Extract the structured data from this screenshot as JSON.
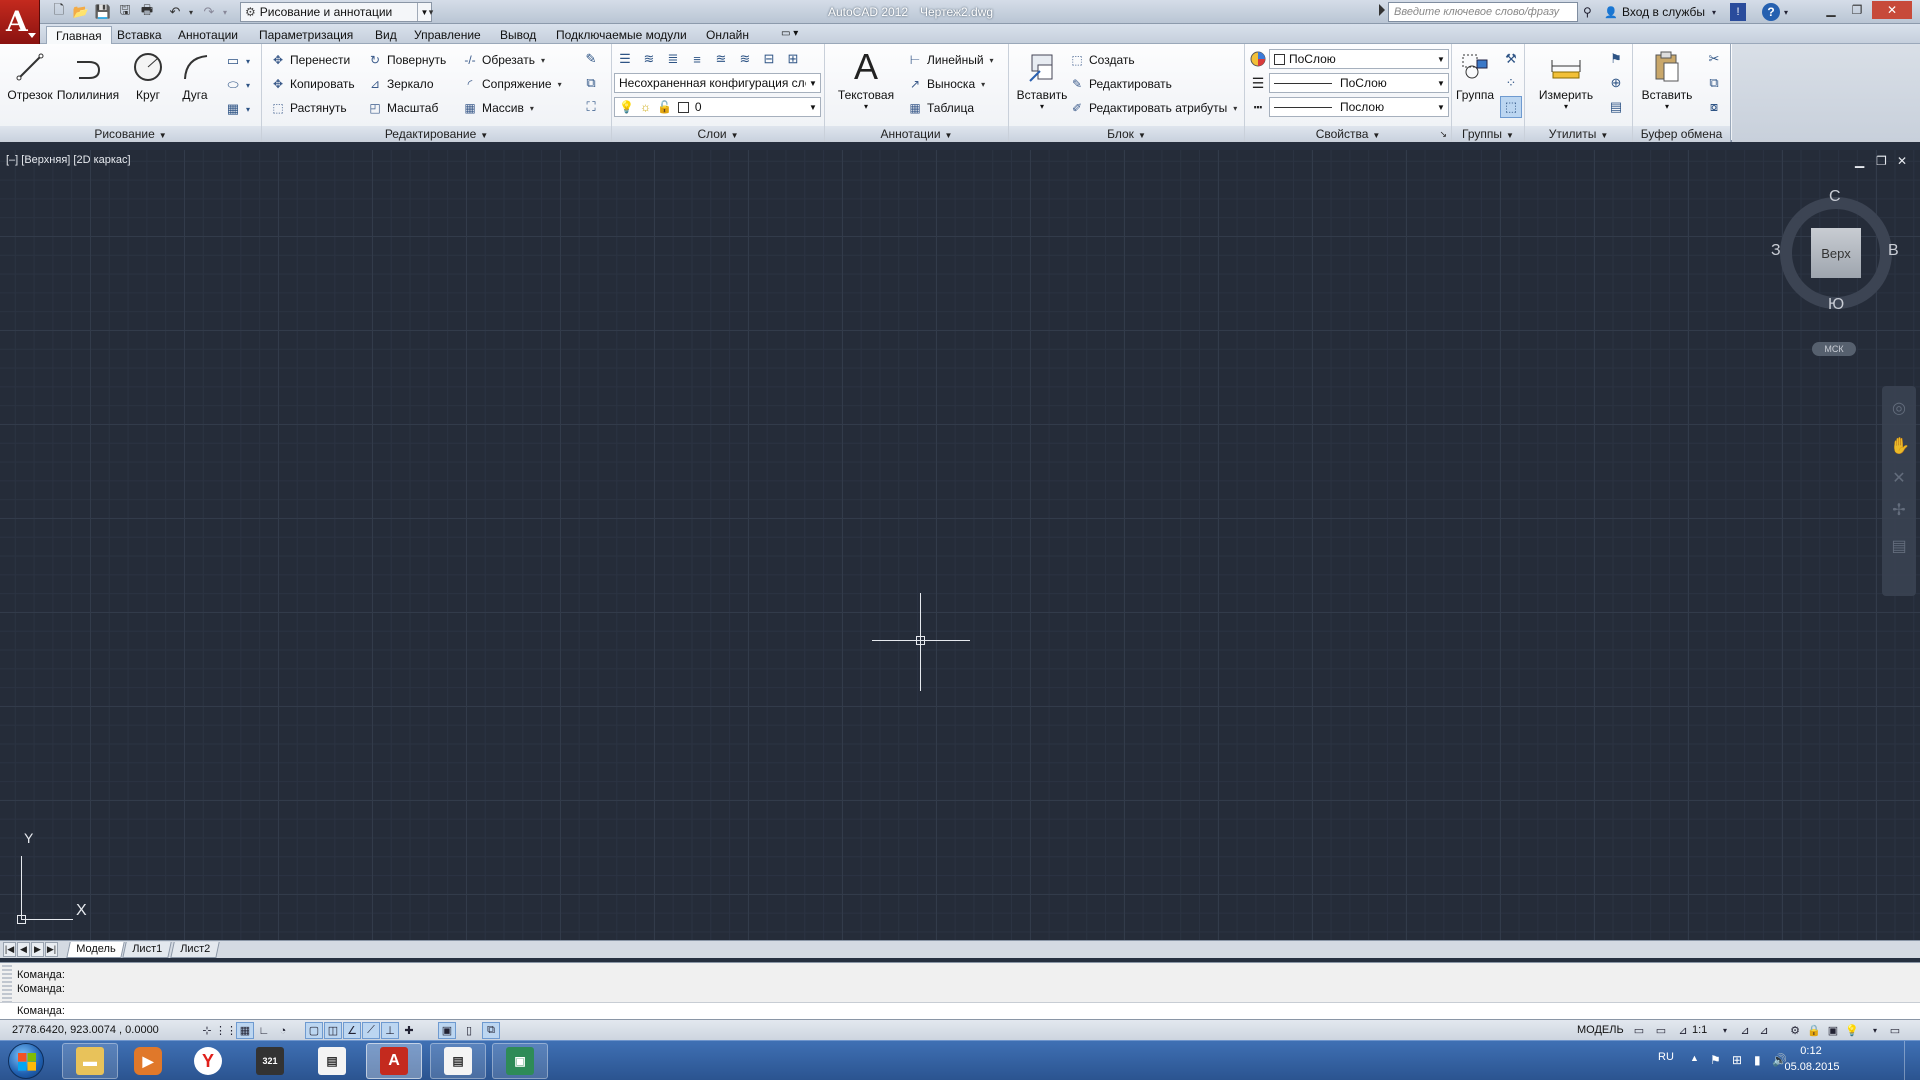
{
  "titlebar": {
    "workspace": "Рисование и аннотации",
    "app_title": "AutoCAD 2012",
    "document": "Чертеж2.dwg",
    "search_placeholder": "Введите ключевое слово/фразу",
    "sign_in": "Вход в службы",
    "help": "?"
  },
  "ribbon_tabs": [
    "Главная",
    "Вставка",
    "Аннотации",
    "Параметризация",
    "Вид",
    "Управление",
    "Вывод",
    "Подключаемые модули",
    "Онлайн"
  ],
  "ribbon": {
    "draw": {
      "title": "Рисование",
      "tools": [
        "Отрезок",
        "Полилиния",
        "Круг",
        "Дуга"
      ]
    },
    "modify": {
      "title": "Редактирование",
      "tools": [
        "Перенести",
        "Повернуть",
        "Обрезать",
        "Копировать",
        "Зеркало",
        "Сопряжение",
        "Растянуть",
        "Масштаб",
        "Массив"
      ]
    },
    "layers": {
      "title": "Слои",
      "state_combo": "Несохраненная конфигурация сло",
      "current_layer": "0"
    },
    "annotation": {
      "title": "Аннотации",
      "text_tool": "Текстовая",
      "text_glyph": "A",
      "tools": [
        "Линейный",
        "Выноска",
        "Таблица"
      ]
    },
    "block": {
      "title": "Блок",
      "insert": "Вставить",
      "tools": [
        "Создать",
        "Редактировать",
        "Редактировать атрибуты"
      ]
    },
    "properties": {
      "title": "Свойства",
      "color": "ПоСлою",
      "lineweight": "ПоСлою",
      "linetype": "Послою"
    },
    "groups": {
      "title": "Группы",
      "tool": "Группа"
    },
    "utilities": {
      "title": "Утилиты",
      "tool": "Измерить"
    },
    "clipboard": {
      "title": "Буфер обмена",
      "tool": "Вставить"
    }
  },
  "viewport": {
    "label": "[–] [Верхняя] [2D каркас]",
    "viewcube": {
      "face": "Верх",
      "north": "С",
      "south": "Ю",
      "east": "В",
      "west": "З"
    },
    "ucs_badge": "МСК",
    "ucs_x": "X",
    "ucs_y": "Y"
  },
  "layout_tabs": [
    "Модель",
    "Лист1",
    "Лист2"
  ],
  "command": {
    "history": [
      "Команда:",
      "Команда:"
    ],
    "prompt": "Команда:"
  },
  "statusbar": {
    "coords": "2778.6420, 923.0074 , 0.0000",
    "model": "МОДЕЛЬ",
    "scale": "1:1"
  },
  "taskbar": {
    "language": "RU",
    "time": "0:12",
    "date": "05.08.2015",
    "media_badge": "321"
  }
}
